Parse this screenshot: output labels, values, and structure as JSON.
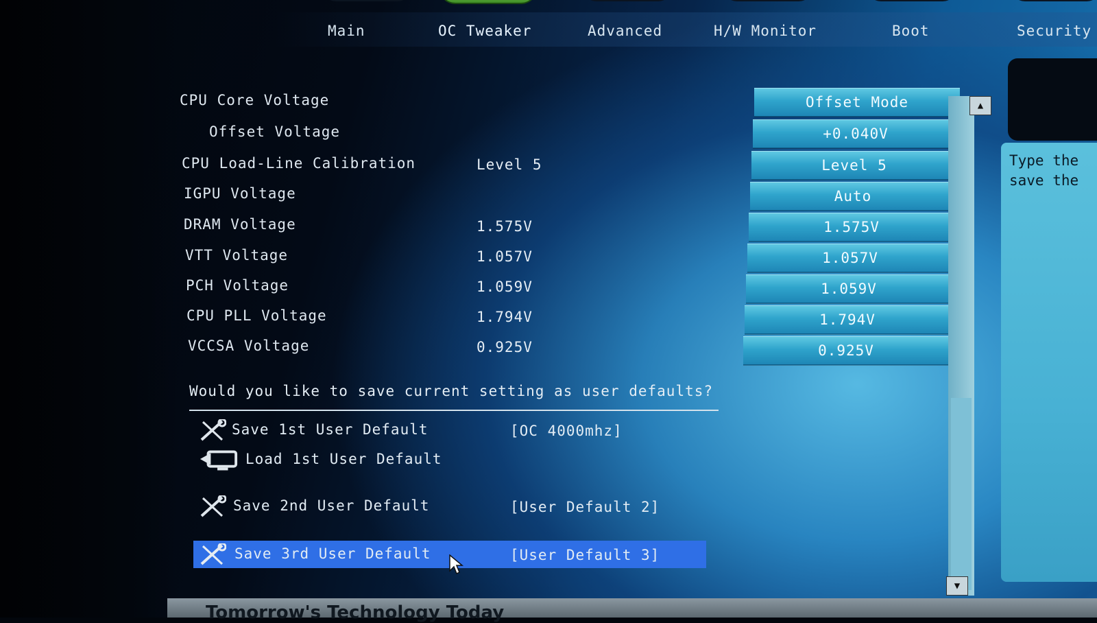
{
  "nav": {
    "tabs": [
      {
        "label": "Main"
      },
      {
        "label": "OC Tweaker"
      },
      {
        "label": "Advanced"
      },
      {
        "label": "H/W Monitor"
      },
      {
        "label": "Boot"
      },
      {
        "label": "Security"
      }
    ],
    "active_tab": "OC Tweaker"
  },
  "settings": [
    {
      "label": "CPU Core Voltage",
      "current": "",
      "value": "Offset Mode"
    },
    {
      "label": "Offset Voltage",
      "current": "",
      "value": "+0.040V"
    },
    {
      "label": "CPU Load-Line Calibration",
      "current": "Level 5",
      "value": "Level 5"
    },
    {
      "label": "IGPU Voltage",
      "current": "",
      "value": "Auto"
    },
    {
      "label": "DRAM Voltage",
      "current": "1.575V",
      "value": "1.575V"
    },
    {
      "label": "VTT Voltage",
      "current": "1.057V",
      "value": "1.057V"
    },
    {
      "label": "PCH Voltage",
      "current": "1.059V",
      "value": "1.059V"
    },
    {
      "label": "CPU PLL Voltage",
      "current": "1.794V",
      "value": "1.794V"
    },
    {
      "label": "VCCSA Voltage",
      "current": "0.925V",
      "value": "0.925V"
    }
  ],
  "user_defaults": {
    "question": "Would you like to save current setting as user defaults?",
    "actions": [
      {
        "label": "Save 1st User Default",
        "profile": "[OC 4000mhz]",
        "icon": "wrench-screwdriver-icon"
      },
      {
        "label": "Load 1st User Default",
        "profile": "",
        "icon": "load-monitor-icon"
      },
      {
        "label": "Save 2nd User Default",
        "profile": "[User Default 2]",
        "icon": "wrench-screwdriver-icon"
      },
      {
        "label": "Save 3rd User Default",
        "profile": "[User Default 3]",
        "icon": "wrench-screwdriver-icon",
        "selected": true
      }
    ]
  },
  "help": {
    "line1": "Type the",
    "line2": "save the"
  },
  "footer": {
    "text": "Tomorrow's Technology Today"
  },
  "colors": {
    "selected_row": "#2f6fe6",
    "value_button": "#2fa4cc",
    "active_tab": "#5fb03a"
  }
}
